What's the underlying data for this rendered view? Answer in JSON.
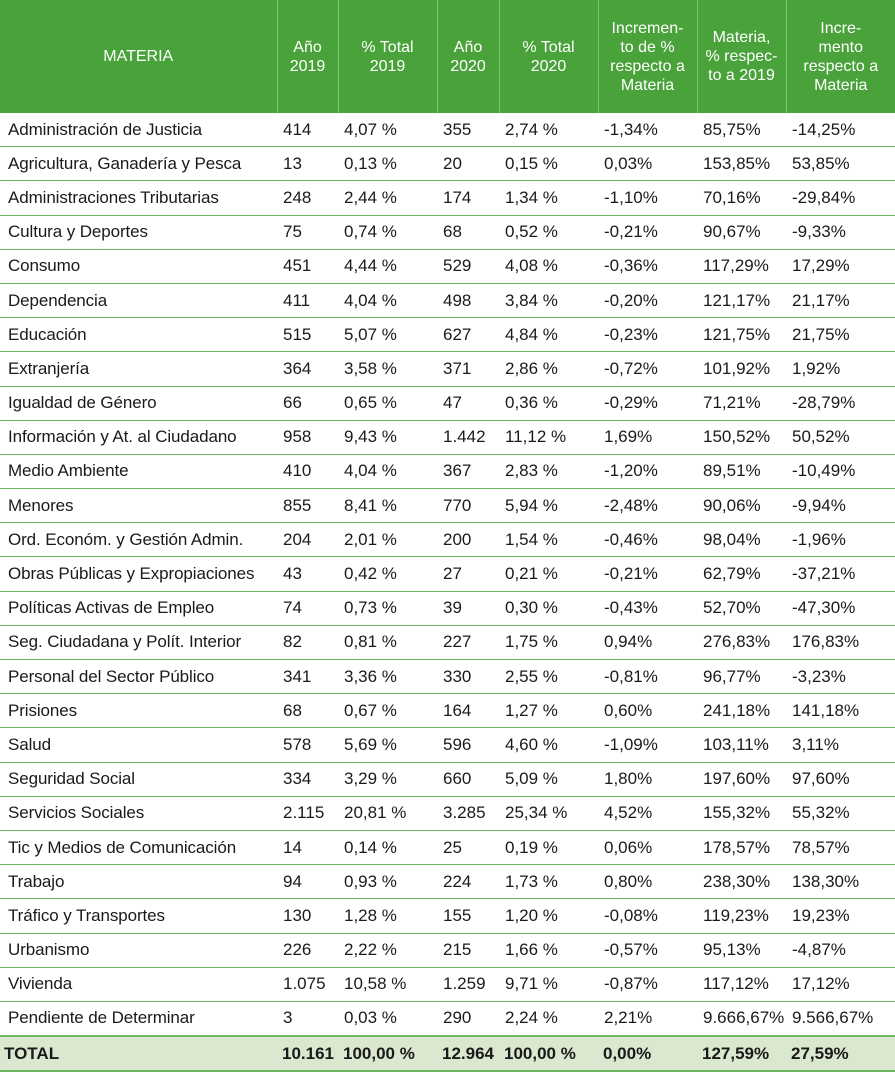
{
  "headers": [
    [
      "MATERIA"
    ],
    [
      "Año",
      "2019"
    ],
    [
      "% Total",
      "2019"
    ],
    [
      "Año",
      "2020"
    ],
    [
      "% Total",
      "2020"
    ],
    [
      "Incremen-",
      "to de %",
      "respecto a",
      "Materia"
    ],
    [
      "Materia,",
      "% respec-",
      "to a 2019"
    ],
    [
      "Incre-",
      "mento",
      "respecto a",
      "Materia"
    ]
  ],
  "rows": [
    [
      "Administración de Justicia",
      "414",
      "4,07 %",
      "355",
      "2,74 %",
      "-1,34%",
      "85,75%",
      "-14,25%"
    ],
    [
      "Agricultura, Ganadería y Pesca",
      "13",
      "0,13 %",
      "20",
      "0,15 %",
      "0,03%",
      "153,85%",
      "53,85%"
    ],
    [
      "Administraciones Tributarias",
      "248",
      "2,44 %",
      "174",
      "1,34 %",
      "-1,10%",
      "70,16%",
      "-29,84%"
    ],
    [
      "Cultura y Deportes",
      "75",
      "0,74 %",
      "68",
      "0,52 %",
      "-0,21%",
      "90,67%",
      "-9,33%"
    ],
    [
      "Consumo",
      "451",
      "4,44 %",
      "529",
      "4,08 %",
      "-0,36%",
      "117,29%",
      "17,29%"
    ],
    [
      "Dependencia",
      "411",
      "4,04 %",
      "498",
      "3,84 %",
      "-0,20%",
      "121,17%",
      "21,17%"
    ],
    [
      "Educación",
      "515",
      "5,07 %",
      "627",
      "4,84 %",
      "-0,23%",
      "121,75%",
      "21,75%"
    ],
    [
      "Extranjería",
      "364",
      "3,58 %",
      "371",
      "2,86 %",
      "-0,72%",
      "101,92%",
      "1,92%"
    ],
    [
      "Igualdad de Género",
      "66",
      "0,65 %",
      "47",
      "0,36 %",
      "-0,29%",
      "71,21%",
      "-28,79%"
    ],
    [
      "Información y At. al Ciudadano",
      "958",
      "9,43 %",
      "1.442",
      "11,12 %",
      "1,69%",
      "150,52%",
      "50,52%"
    ],
    [
      "Medio Ambiente",
      "410",
      "4,04 %",
      "367",
      "2,83 %",
      "-1,20%",
      "89,51%",
      "-10,49%"
    ],
    [
      "Menores",
      "855",
      "8,41 %",
      "770",
      "5,94 %",
      "-2,48%",
      "90,06%",
      "-9,94%"
    ],
    [
      "Ord. Económ. y Gestión Admin.",
      "204",
      "2,01 %",
      "200",
      "1,54 %",
      "-0,46%",
      "98,04%",
      "-1,96%"
    ],
    [
      "Obras Públicas y Expropiaciones",
      "43",
      "0,42 %",
      "27",
      "0,21 %",
      "-0,21%",
      "62,79%",
      "-37,21%"
    ],
    [
      "Políticas Activas de Empleo",
      "74",
      "0,73 %",
      "39",
      "0,30 %",
      "-0,43%",
      "52,70%",
      "-47,30%"
    ],
    [
      "Seg. Ciudadana y Polít. Interior",
      "82",
      "0,81 %",
      "227",
      "1,75 %",
      "0,94%",
      "276,83%",
      "176,83%"
    ],
    [
      "Personal del Sector Público",
      "341",
      "3,36 %",
      "330",
      "2,55 %",
      "-0,81%",
      "96,77%",
      "-3,23%"
    ],
    [
      "Prisiones",
      "68",
      "0,67 %",
      "164",
      "1,27 %",
      "0,60%",
      "241,18%",
      "141,18%"
    ],
    [
      "Salud",
      "578",
      "5,69 %",
      "596",
      "4,60 %",
      "-1,09%",
      "103,11%",
      "3,11%"
    ],
    [
      "Seguridad Social",
      "334",
      "3,29 %",
      "660",
      "5,09 %",
      "1,80%",
      "197,60%",
      "97,60%"
    ],
    [
      "Servicios Sociales",
      "2.115",
      "20,81 %",
      "3.285",
      "25,34 %",
      "4,52%",
      "155,32%",
      "55,32%"
    ],
    [
      "Tic y Medios de Comunicación",
      "14",
      "0,14 %",
      "25",
      "0,19 %",
      "0,06%",
      "178,57%",
      "78,57%"
    ],
    [
      "Trabajo",
      "94",
      "0,93 %",
      "224",
      "1,73 %",
      "0,80%",
      "238,30%",
      "138,30%"
    ],
    [
      "Tráfico y Transportes",
      "130",
      "1,28 %",
      "155",
      "1,20 %",
      "-0,08%",
      "119,23%",
      "19,23%"
    ],
    [
      "Urbanismo",
      "226",
      "2,22 %",
      "215",
      "1,66 %",
      "-0,57%",
      "95,13%",
      "-4,87%"
    ],
    [
      "Vivienda",
      "1.075",
      "10,58 %",
      "1.259",
      "9,71 %",
      "-0,87%",
      "117,12%",
      "17,12%"
    ],
    [
      "Pendiente de Determinar",
      "3",
      "0,03 %",
      "290",
      "2,24 %",
      "2,21%",
      "9.666,67%",
      "9.566,67%"
    ]
  ],
  "total": [
    "TOTAL",
    "10.161",
    "100,00 %",
    "12.964",
    "100,00 %",
    "0,00%",
    "127,59%",
    "27,59%"
  ],
  "colors": {
    "header_bg": "#4aa33a",
    "header_text": "#ffffff",
    "row_line": "#6fb862",
    "total_bg": "#d9e8cf"
  }
}
